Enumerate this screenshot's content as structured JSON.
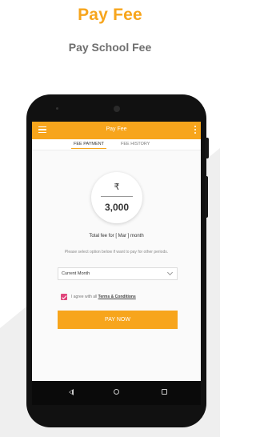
{
  "hero": {
    "title": "Pay Fee",
    "subtitle": "Pay School Fee"
  },
  "appbar": {
    "title": "Pay Fee",
    "menu_icon": "hamburger-menu-icon",
    "overflow_icon": "kebab-menu-icon"
  },
  "tabs": [
    {
      "label": "FEE PAYMENT",
      "active": true
    },
    {
      "label": "FEE HISTORY",
      "active": false
    }
  ],
  "amount": {
    "currency_symbol": "₹",
    "value": "3,000"
  },
  "total_text": "Total fee for [ Mar ] month",
  "hint_text": "Please select option below if want to pay for other periods.",
  "period_select": {
    "value": "Current Month"
  },
  "agree": {
    "checked": true,
    "prefix": "I agree with all ",
    "link": "Terms & Conditions"
  },
  "pay_button": "PAY NOW",
  "colors": {
    "accent": "#f7a51c",
    "checkbox": "#e0457b",
    "hero_subtitle": "#6f6f6f"
  }
}
